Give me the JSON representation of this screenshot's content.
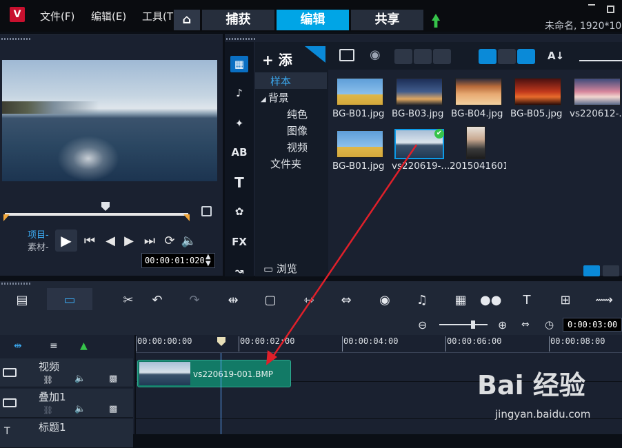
{
  "app": {
    "project": "未命名, 1920*10",
    "menu": [
      "文件(F)",
      "编辑(E)",
      "工具(T)"
    ],
    "tabs": {
      "capture": "捕获",
      "edit": "编辑",
      "share": "共享"
    },
    "accent": "#00a5e6"
  },
  "player": {
    "label_project": "项目-",
    "label_clip": "素材-",
    "timecode": "00:00:01:020"
  },
  "library": {
    "tree": {
      "add_label": "+ 添",
      "items": [
        "样本",
        "背景",
        "纯色",
        "图像",
        "视频",
        "文件夹"
      ],
      "browse": "浏览"
    },
    "thumbs": [
      {
        "name": "BG-B01.jpg"
      },
      {
        "name": "BG-B03.jpg"
      },
      {
        "name": "BG-B04.jpg"
      },
      {
        "name": "BG-B05.jpg"
      },
      {
        "name": "vs220612-..."
      },
      {
        "name": "BG-B01.jpg"
      },
      {
        "name": "vs220619-..."
      },
      {
        "name": "2015041601..."
      }
    ]
  },
  "timeline": {
    "duration": "0:00:03:00",
    "ruler": [
      "00:00:00:00",
      "00:00:02:00",
      "00:00:04:00",
      "00:00:06:00",
      "00:00:08:00"
    ],
    "tracks": [
      "视频",
      "叠加1",
      "标题1"
    ],
    "clip": {
      "name": "vs220619-001.BMP",
      "color": "#127a66"
    }
  },
  "watermark": {
    "brand": "Bai 经验",
    "url": "jingyan.baidu.com"
  }
}
